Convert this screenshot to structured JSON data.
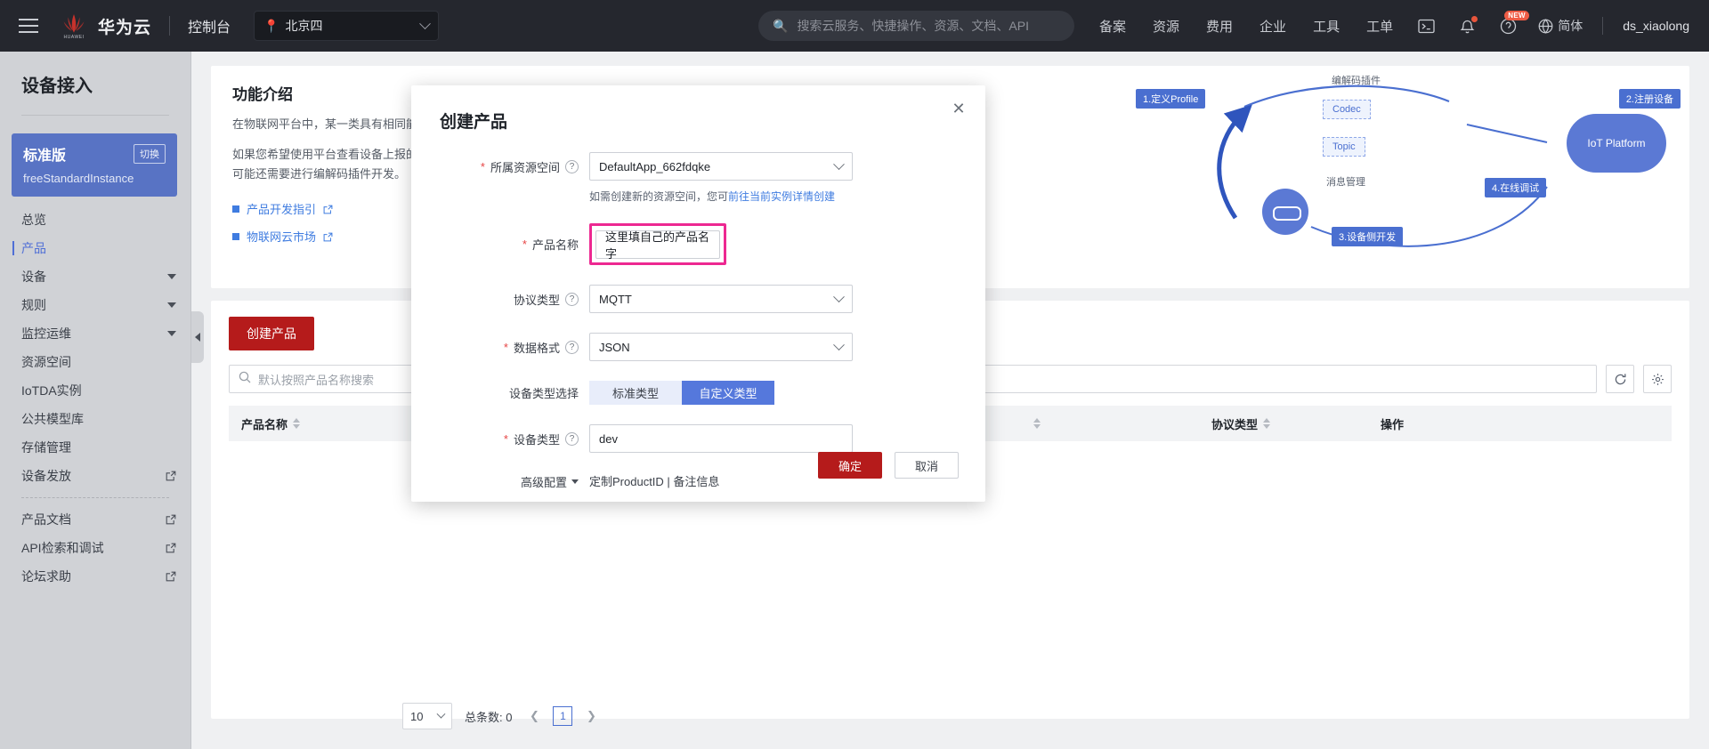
{
  "header": {
    "menu_icon": "hamburger-icon",
    "brand": "华为云",
    "console": "控制台",
    "region": "北京四",
    "region_icon": "location-pin-icon",
    "search_placeholder": "搜索云服务、快捷操作、资源、文档、API",
    "search_icon": "search-icon",
    "nav": [
      "备案",
      "资源",
      "费用",
      "企业",
      "工具",
      "工单"
    ],
    "icons": {
      "terminal": "terminal-icon",
      "bell": "bell-icon",
      "help": "help-circle-icon",
      "help_badge": "NEW",
      "globe": "globe-icon"
    },
    "lang": "简体",
    "username": "ds_xiaolong"
  },
  "sidebar": {
    "title": "设备接入",
    "instance": {
      "edition": "标准版",
      "switch_label": "切换",
      "name": "freeStandardInstance"
    },
    "items": [
      {
        "label": "总览",
        "active": false,
        "expandable": false,
        "external": false
      },
      {
        "label": "产品",
        "active": true,
        "expandable": false,
        "external": false
      },
      {
        "label": "设备",
        "active": false,
        "expandable": true,
        "external": false
      },
      {
        "label": "规则",
        "active": false,
        "expandable": true,
        "external": false
      },
      {
        "label": "监控运维",
        "active": false,
        "expandable": true,
        "external": false
      },
      {
        "label": "资源空间",
        "active": false,
        "expandable": false,
        "external": false
      },
      {
        "label": "IoTDA实例",
        "active": false,
        "expandable": false,
        "external": false
      },
      {
        "label": "公共模型库",
        "active": false,
        "expandable": false,
        "external": false
      },
      {
        "label": "存储管理",
        "active": false,
        "expandable": false,
        "external": false
      },
      {
        "label": "设备发放",
        "active": false,
        "expandable": false,
        "external": true
      },
      {
        "label": "产品文档",
        "active": false,
        "expandable": false,
        "external": true
      },
      {
        "label": "API检索和调试",
        "active": false,
        "expandable": false,
        "external": true
      },
      {
        "label": "论坛求助",
        "active": false,
        "expandable": false,
        "external": true
      }
    ],
    "collapse_icon": "collapse-left-icon"
  },
  "main": {
    "intro": {
      "title": "功能介绍",
      "para1": "在物联网平台中，某一类具有相同能力或特征的设备的合集被称为一款产品。",
      "para2": "如果您希望使用平台查看设备上报的数据信息，并对设备进行控制，您需要创建产品并为该产品定义物模型。根据产品的接入协议、数据格式等可能还需要进行编解码插件开发。",
      "links": [
        {
          "text": "产品开发指引",
          "icon": "external-link-icon"
        },
        {
          "text": "物联网云市场",
          "icon": "external-link-icon"
        }
      ]
    },
    "diagram": {
      "steps": [
        "1.定义Profile",
        "2.注册设备",
        "3.设备侧开发",
        "4.在线调试"
      ],
      "nodes": [
        "Codec",
        "Topic",
        "IoT Platform"
      ],
      "labels": [
        "编解码插件",
        "消息管理"
      ]
    },
    "create_button": "创建产品",
    "search_placeholder": "默认按照产品名称搜索",
    "search_icon": "search-icon",
    "refresh_icon": "refresh-icon",
    "settings_icon": "gear-icon",
    "table": {
      "columns": [
        "产品名称",
        "",
        "",
        "协议类型",
        "操作"
      ],
      "rows": []
    },
    "pagination": {
      "page_size": "10",
      "total_label": "总条数: 0",
      "prev_icon": "chevron-left-icon",
      "next_icon": "chevron-right-icon",
      "current_page": "1"
    }
  },
  "modal": {
    "title": "创建产品",
    "close_icon": "close-icon",
    "fields": {
      "resource_space": {
        "label": "所属资源空间",
        "required": true,
        "help_icon": "help-circle-icon",
        "value": "DefaultApp_662fdqke",
        "hint_prefix": "如需创建新的资源空间，您可",
        "hint_link": "前往当前实例详情创建"
      },
      "product_name": {
        "label": "产品名称",
        "required": true,
        "value": "这里填自己的产品名字",
        "highlight_color": "#ed2891"
      },
      "protocol_type": {
        "label": "协议类型",
        "required": false,
        "help_icon": "help-circle-icon",
        "value": "MQTT"
      },
      "data_format": {
        "label": "数据格式",
        "required": true,
        "help_icon": "help-circle-icon",
        "value": "JSON"
      },
      "device_type_select": {
        "label": "设备类型选择",
        "options": [
          "标准类型",
          "自定义类型"
        ],
        "selected": "自定义类型"
      },
      "device_type": {
        "label": "设备类型",
        "required": true,
        "help_icon": "help-circle-icon",
        "value": "dev"
      },
      "advanced": {
        "label": "高级配置",
        "caret_icon": "caret-down-icon",
        "values": "定制ProductID | 备注信息"
      }
    },
    "buttons": {
      "ok": "确定",
      "cancel": "取消"
    }
  }
}
